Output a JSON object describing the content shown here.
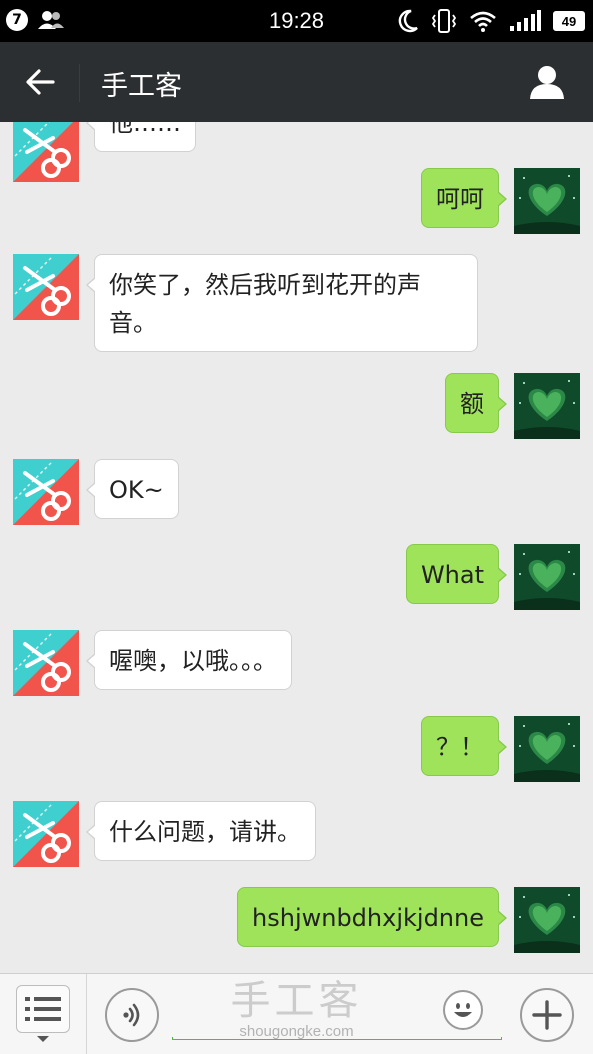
{
  "status_bar": {
    "badge_count": "7",
    "time": "19:28",
    "battery": "49"
  },
  "header": {
    "title": "手工客"
  },
  "messages": [
    {
      "side": "left",
      "text": "他……"
    },
    {
      "side": "right",
      "text": "呵呵"
    },
    {
      "side": "left",
      "text": "你笑了，然后我听到花开的声音。"
    },
    {
      "side": "right",
      "text": "额"
    },
    {
      "side": "left",
      "text": "OK~"
    },
    {
      "side": "right",
      "text": "What"
    },
    {
      "side": "left",
      "text": "喔噢，以哦。。。"
    },
    {
      "side": "right",
      "text": "？！"
    },
    {
      "side": "left",
      "text": "什么问题，请讲。"
    },
    {
      "side": "right",
      "text": "hshjwnbdhxjkjdnne"
    }
  ],
  "watermark": {
    "main": "手工客",
    "sub": "shougongke.com"
  },
  "colors": {
    "titlebar": "#2c2f31",
    "bubble_right": "#9fe35b",
    "bubble_left": "#ffffff",
    "chat_bg": "#ebebeb",
    "bot_avatar_cyan": "#3fcfcf",
    "bot_avatar_red": "#f0544a"
  },
  "icons": {
    "back": "back-arrow-icon",
    "profile": "person-icon",
    "menu": "menu-list-icon",
    "voice": "voice-icon",
    "emoji": "smiley-icon",
    "plus": "plus-icon"
  }
}
